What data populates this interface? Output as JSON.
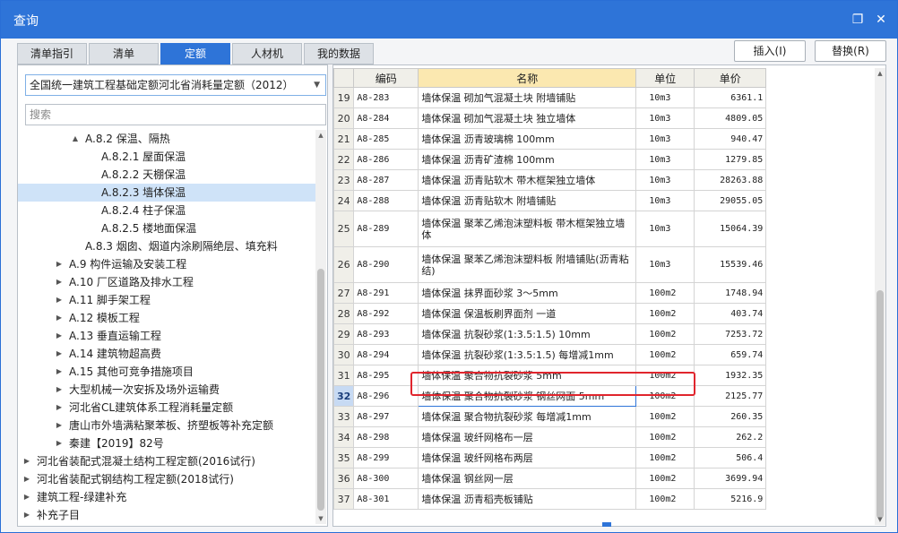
{
  "window": {
    "title": "查询",
    "restore_glyph": "❐",
    "close_glyph": "✕"
  },
  "tabs": [
    {
      "label": "清单指引",
      "active": false
    },
    {
      "label": "清单",
      "active": false
    },
    {
      "label": "定额",
      "active": true
    },
    {
      "label": "人材机",
      "active": false
    },
    {
      "label": "我的数据",
      "active": false
    }
  ],
  "buttons": {
    "insert": "插入(I)",
    "replace": "替换(R)"
  },
  "left": {
    "quota_select": "全国统一建筑工程基础定额河北省消耗量定额（2012）",
    "search_placeholder": "搜索",
    "tree": [
      {
        "label": "A.8.2 保温、隔热",
        "indent": 4,
        "toggle": "▲",
        "selected": false
      },
      {
        "label": "A.8.2.1 屋面保温",
        "indent": 5,
        "toggle": "",
        "selected": false
      },
      {
        "label": "A.8.2.2 天棚保温",
        "indent": 5,
        "toggle": "",
        "selected": false
      },
      {
        "label": "A.8.2.3 墙体保温",
        "indent": 5,
        "toggle": "",
        "selected": true
      },
      {
        "label": "A.8.2.4 柱子保温",
        "indent": 5,
        "toggle": "",
        "selected": false
      },
      {
        "label": "A.8.2.5 楼地面保温",
        "indent": 5,
        "toggle": "",
        "selected": false
      },
      {
        "label": "A.8.3 烟囱、烟道内涂刷隔绝层、填充料",
        "indent": 4,
        "toggle": "",
        "selected": false
      },
      {
        "label": "A.9 构件运输及安装工程",
        "indent": 3,
        "toggle": "▶",
        "selected": false
      },
      {
        "label": "A.10 厂区道路及排水工程",
        "indent": 3,
        "toggle": "▶",
        "selected": false
      },
      {
        "label": "A.11 脚手架工程",
        "indent": 3,
        "toggle": "▶",
        "selected": false
      },
      {
        "label": "A.12 模板工程",
        "indent": 3,
        "toggle": "▶",
        "selected": false
      },
      {
        "label": "A.13 垂直运输工程",
        "indent": 3,
        "toggle": "▶",
        "selected": false
      },
      {
        "label": "A.14 建筑物超高费",
        "indent": 3,
        "toggle": "▶",
        "selected": false
      },
      {
        "label": "A.15 其他可竞争措施项目",
        "indent": 3,
        "toggle": "▶",
        "selected": false
      },
      {
        "label": "大型机械一次安拆及场外运输费",
        "indent": 3,
        "toggle": "▶",
        "selected": false
      },
      {
        "label": "河北省CL建筑体系工程消耗量定额",
        "indent": 3,
        "toggle": "▶",
        "selected": false
      },
      {
        "label": "唐山市外墙满粘聚苯板、挤塑板等补充定额",
        "indent": 3,
        "toggle": "▶",
        "selected": false
      },
      {
        "label": "秦建【2019】82号",
        "indent": 3,
        "toggle": "▶",
        "selected": false
      },
      {
        "label": "河北省装配式混凝土结构工程定额(2016试行)",
        "indent": 1,
        "toggle": "▶",
        "selected": false
      },
      {
        "label": "河北省装配式钢结构工程定额(2018试行)",
        "indent": 1,
        "toggle": "▶",
        "selected": false
      },
      {
        "label": "建筑工程-绿建补充",
        "indent": 1,
        "toggle": "▶",
        "selected": false
      },
      {
        "label": "补充子目",
        "indent": 1,
        "toggle": "▶",
        "selected": false
      }
    ]
  },
  "table": {
    "headers": {
      "code": "编码",
      "name": "名称",
      "unit": "单位",
      "price": "单价"
    },
    "rows": [
      {
        "n": "19",
        "code": "A8-283",
        "name": "墙体保温 砌加气混凝土块 附墙铺贴",
        "unit": "10m3",
        "price": "6361.1"
      },
      {
        "n": "20",
        "code": "A8-284",
        "name": "墙体保温 砌加气混凝土块 独立墙体",
        "unit": "10m3",
        "price": "4809.05"
      },
      {
        "n": "21",
        "code": "A8-285",
        "name": "墙体保温 沥青玻璃棉 100mm",
        "unit": "10m3",
        "price": "940.47"
      },
      {
        "n": "22",
        "code": "A8-286",
        "name": "墙体保温 沥青矿渣棉 100mm",
        "unit": "10m3",
        "price": "1279.85"
      },
      {
        "n": "23",
        "code": "A8-287",
        "name": "墙体保温 沥青贴软木 带木框架独立墙体",
        "unit": "10m3",
        "price": "28263.88"
      },
      {
        "n": "24",
        "code": "A8-288",
        "name": "墙体保温 沥青贴软木 附墙铺贴",
        "unit": "10m3",
        "price": "29055.05"
      },
      {
        "n": "25",
        "code": "A8-289",
        "name": "墙体保温 聚苯乙烯泡沫塑料板 带木框架独立墙体",
        "unit": "10m3",
        "price": "15064.39"
      },
      {
        "n": "26",
        "code": "A8-290",
        "name": "墙体保温 聚苯乙烯泡沫塑料板 附墙铺贴(沥青粘结)",
        "unit": "10m3",
        "price": "15539.46"
      },
      {
        "n": "27",
        "code": "A8-291",
        "name": "墙体保温 抹界面砂浆 3～5mm",
        "unit": "100m2",
        "price": "1748.94"
      },
      {
        "n": "28",
        "code": "A8-292",
        "name": "墙体保温 保温板刷界面剂 一道",
        "unit": "100m2",
        "price": "403.74"
      },
      {
        "n": "29",
        "code": "A8-293",
        "name": "墙体保温 抗裂砂浆(1:3.5:1.5) 10mm",
        "unit": "100m2",
        "price": "7253.72"
      },
      {
        "n": "30",
        "code": "A8-294",
        "name": "墙体保温 抗裂砂浆(1:3.5:1.5) 每增减1mm",
        "unit": "100m2",
        "price": "659.74"
      },
      {
        "n": "31",
        "code": "A8-295",
        "name": "墙体保温 聚合物抗裂砂浆 5mm",
        "unit": "100m2",
        "price": "1932.35"
      },
      {
        "n": "32",
        "code": "A8-296",
        "name": "墙体保温 聚合物抗裂砂浆 钢丝网面 5mm",
        "unit": "100m2",
        "price": "2125.77"
      },
      {
        "n": "33",
        "code": "A8-297",
        "name": "墙体保温 聚合物抗裂砂浆 每增减1mm",
        "unit": "100m2",
        "price": "260.35"
      },
      {
        "n": "34",
        "code": "A8-298",
        "name": "墙体保温 玻纤网格布一层",
        "unit": "100m2",
        "price": "262.2"
      },
      {
        "n": "35",
        "code": "A8-299",
        "name": "墙体保温 玻纤网格布两层",
        "unit": "100m2",
        "price": "506.4"
      },
      {
        "n": "36",
        "code": "A8-300",
        "name": "墙体保温 钢丝网一层",
        "unit": "100m2",
        "price": "3699.94"
      },
      {
        "n": "37",
        "code": "A8-301",
        "name": "墙体保温 沥青稻壳板铺贴",
        "unit": "100m2",
        "price": "5216.9"
      }
    ],
    "selected_row": "32"
  }
}
